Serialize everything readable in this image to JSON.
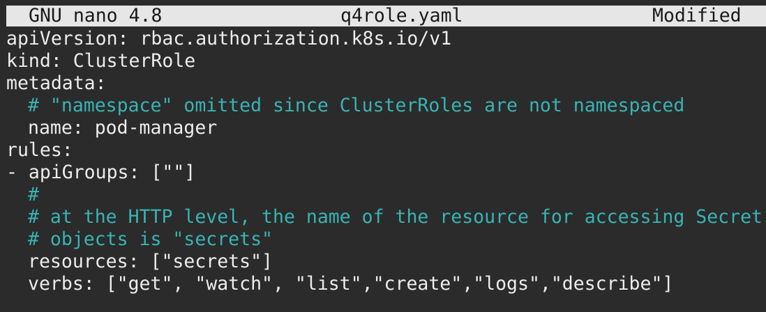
{
  "titlebar": {
    "app": "GNU nano 4.8",
    "filename": "q4role.yaml",
    "status": "Modified"
  },
  "editor": {
    "lines": [
      {
        "text": "apiVersion: rbac.authorization.k8s.io/v1",
        "kind": "code",
        "indent": false
      },
      {
        "text": "kind: ClusterRole",
        "kind": "code",
        "indent": false
      },
      {
        "text": "metadata:",
        "kind": "code",
        "indent": false
      },
      {
        "text": "# \"namespace\" omitted since ClusterRoles are not namespaced",
        "kind": "comment",
        "indent": true
      },
      {
        "text": "name: pod-manager",
        "kind": "code",
        "indent": true
      },
      {
        "text": "rules:",
        "kind": "code",
        "indent": false
      },
      {
        "text": "- apiGroups: [\"\"]",
        "kind": "code",
        "indent": false
      },
      {
        "text": "#",
        "kind": "comment",
        "indent": true
      },
      {
        "text": "# at the HTTP level, the name of the resource for accessing Secret",
        "kind": "comment",
        "indent": true
      },
      {
        "text": "# objects is \"secrets\"",
        "kind": "comment",
        "indent": true
      },
      {
        "text": "resources: [\"secrets\"]",
        "kind": "code",
        "indent": true
      },
      {
        "text": "verbs: [\"get\", \"watch\", \"list\",\"create\",\"logs\",\"describe\"]",
        "kind": "code",
        "indent": true
      }
    ]
  },
  "colors": {
    "background": "#2b2b2b",
    "text": "#ececec",
    "comment": "#39b3b3",
    "titlebar_bg": "#e6e6e6",
    "titlebar_text": "#1a1a1a"
  }
}
